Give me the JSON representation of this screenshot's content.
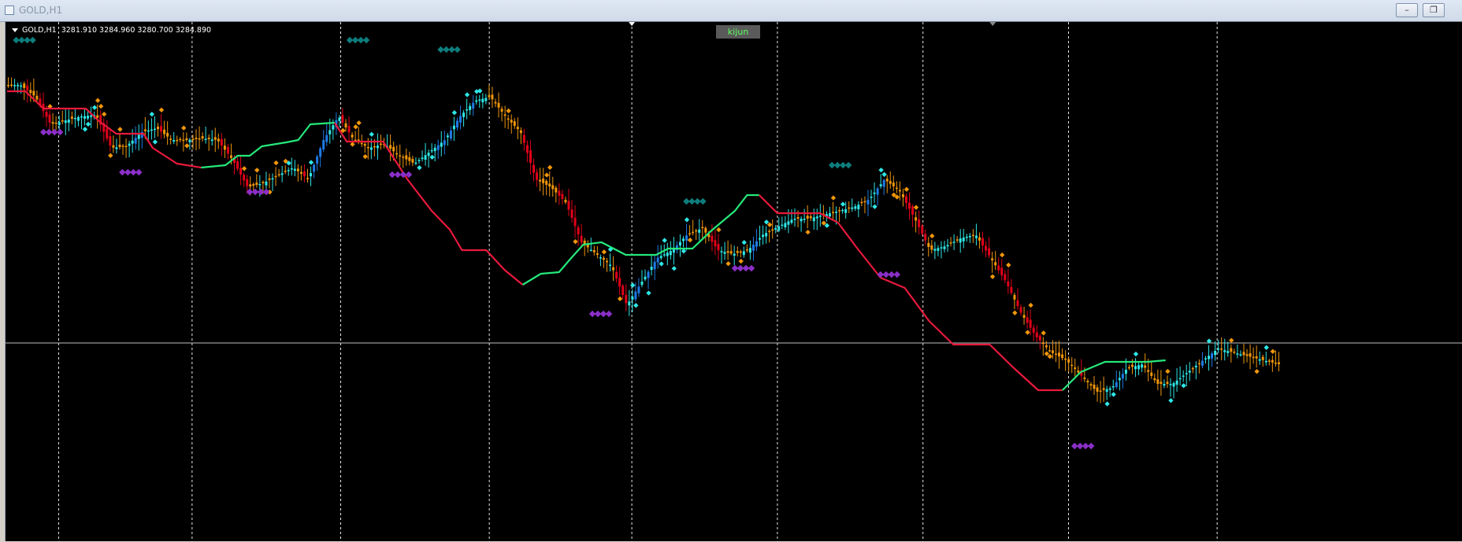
{
  "window": {
    "title": "GOLD,H1",
    "minimize_icon": "minimize-icon",
    "restore_icon": "restore-icon"
  },
  "chart": {
    "symbol_info": "GOLD,H1  3281.910 3284.960 3280.700 3284.890",
    "indicator_button": "kijun",
    "colors": {
      "background": "#000000",
      "grid": "#ffffff",
      "crosshair": "#bfbfbf",
      "bull_strong": "#1e7ae6",
      "bull_weak": "#2ee6e6",
      "bear_strong": "#e0001a",
      "bear_weak": "#f0960a",
      "kijun_bear": "#e8193c",
      "kijun_bull": "#25e87a",
      "marker_top": "#0e7d7d",
      "marker_bottom": "#8b2fc9",
      "swing_dot": "#f0960a"
    }
  },
  "chart_data": {
    "type": "candlestick",
    "title": "GOLD,H1",
    "ohlc_last": {
      "open": 3281.91,
      "high": 3284.96,
      "low": 3280.7,
      "close": 3284.89
    },
    "ylim": [
      0,
      650
    ],
    "y_axis_inverted": true,
    "x_axis": "bar index (hourly)",
    "close_path": [
      [
        0,
        80
      ],
      [
        5,
        80
      ],
      [
        10,
        95
      ],
      [
        15,
        130
      ],
      [
        20,
        125
      ],
      [
        25,
        120
      ],
      [
        30,
        118
      ],
      [
        35,
        160
      ],
      [
        40,
        158
      ],
      [
        45,
        140
      ],
      [
        50,
        135
      ],
      [
        55,
        150
      ],
      [
        60,
        150
      ],
      [
        65,
        148
      ],
      [
        70,
        150
      ],
      [
        75,
        175
      ],
      [
        80,
        210
      ],
      [
        85,
        205
      ],
      [
        90,
        195
      ],
      [
        95,
        185
      ],
      [
        100,
        200
      ],
      [
        105,
        150
      ],
      [
        110,
        120
      ],
      [
        115,
        150
      ],
      [
        120,
        160
      ],
      [
        125,
        155
      ],
      [
        130,
        170
      ],
      [
        135,
        180
      ],
      [
        140,
        165
      ],
      [
        145,
        150
      ],
      [
        150,
        120
      ],
      [
        155,
        100
      ],
      [
        160,
        95
      ],
      [
        165,
        120
      ],
      [
        170,
        140
      ],
      [
        175,
        200
      ],
      [
        180,
        210
      ],
      [
        185,
        230
      ],
      [
        190,
        280
      ],
      [
        195,
        295
      ],
      [
        200,
        310
      ],
      [
        205,
        360
      ],
      [
        210,
        330
      ],
      [
        215,
        300
      ],
      [
        220,
        290
      ],
      [
        225,
        270
      ],
      [
        230,
        262
      ],
      [
        235,
        290
      ],
      [
        240,
        295
      ],
      [
        245,
        290
      ],
      [
        250,
        270
      ],
      [
        255,
        260
      ],
      [
        260,
        250
      ],
      [
        265,
        250
      ],
      [
        270,
        245
      ],
      [
        275,
        240
      ],
      [
        280,
        235
      ],
      [
        285,
        225
      ],
      [
        290,
        200
      ],
      [
        295,
        215
      ],
      [
        300,
        250
      ],
      [
        305,
        290
      ],
      [
        310,
        285
      ],
      [
        315,
        275
      ],
      [
        320,
        270
      ],
      [
        325,
        300
      ],
      [
        330,
        330
      ],
      [
        335,
        370
      ],
      [
        340,
        400
      ],
      [
        345,
        420
      ],
      [
        350,
        430
      ],
      [
        355,
        450
      ],
      [
        360,
        470
      ],
      [
        365,
        465
      ],
      [
        370,
        440
      ],
      [
        375,
        435
      ],
      [
        380,
        460
      ],
      [
        385,
        460
      ],
      [
        390,
        445
      ],
      [
        395,
        430
      ],
      [
        400,
        415
      ],
      [
        405,
        420
      ],
      [
        410,
        425
      ],
      [
        415,
        430
      ],
      [
        420,
        435
      ]
    ],
    "kijun_segments": [
      {
        "trend": "bear",
        "points": [
          [
            0,
            88
          ],
          [
            6,
            88
          ],
          [
            12,
            110
          ],
          [
            26,
            110
          ],
          [
            30,
            125
          ],
          [
            36,
            142
          ],
          [
            45,
            142
          ],
          [
            48,
            160
          ],
          [
            56,
            180
          ],
          [
            64,
            185
          ]
        ]
      },
      {
        "trend": "bull",
        "points": [
          [
            64,
            185
          ],
          [
            72,
            182
          ],
          [
            76,
            170
          ],
          [
            80,
            170
          ],
          [
            84,
            158
          ],
          [
            92,
            153
          ],
          [
            96,
            150
          ],
          [
            100,
            130
          ],
          [
            108,
            128
          ]
        ]
      },
      {
        "trend": "bear",
        "points": [
          [
            108,
            128
          ],
          [
            112,
            152
          ],
          [
            124,
            152
          ],
          [
            132,
            200
          ],
          [
            140,
            240
          ],
          [
            146,
            264
          ],
          [
            150,
            290
          ],
          [
            158,
            290
          ],
          [
            164,
            315
          ],
          [
            170,
            334
          ]
        ]
      },
      {
        "trend": "bull",
        "points": [
          [
            170,
            334
          ],
          [
            176,
            320
          ],
          [
            182,
            318
          ],
          [
            186,
            300
          ],
          [
            190,
            283
          ],
          [
            196,
            280
          ],
          [
            204,
            296
          ],
          [
            214,
            296
          ],
          [
            218,
            288
          ],
          [
            226,
            288
          ],
          [
            232,
            266
          ],
          [
            240,
            240
          ],
          [
            244,
            220
          ],
          [
            248,
            220
          ]
        ]
      },
      {
        "trend": "bear",
        "points": [
          [
            248,
            220
          ],
          [
            254,
            243
          ],
          [
            268,
            243
          ],
          [
            274,
            255
          ],
          [
            280,
            286
          ],
          [
            288,
            325
          ],
          [
            296,
            338
          ],
          [
            304,
            380
          ],
          [
            312,
            410
          ],
          [
            324,
            410
          ],
          [
            332,
            440
          ],
          [
            340,
            468
          ],
          [
            348,
            468
          ]
        ]
      },
      {
        "trend": "bull",
        "points": [
          [
            348,
            468
          ],
          [
            354,
            445
          ],
          [
            362,
            432
          ],
          [
            376,
            432
          ],
          [
            382,
            430
          ]
        ]
      }
    ],
    "marker_clusters": [
      {
        "position": "top",
        "x": 3,
        "y": 23
      },
      {
        "position": "bottom",
        "x": 12,
        "y": 140
      },
      {
        "position": "bottom",
        "x": 38,
        "y": 191
      },
      {
        "position": "bottom",
        "x": 80,
        "y": 216
      },
      {
        "position": "top",
        "x": 113,
        "y": 23
      },
      {
        "position": "bottom",
        "x": 127,
        "y": 194
      },
      {
        "position": "top",
        "x": 143,
        "y": 35
      },
      {
        "position": "bottom",
        "x": 193,
        "y": 371
      },
      {
        "position": "top",
        "x": 224,
        "y": 228
      },
      {
        "position": "bottom",
        "x": 240,
        "y": 313
      },
      {
        "position": "top",
        "x": 272,
        "y": 182
      },
      {
        "position": "bottom",
        "x": 288,
        "y": 321
      },
      {
        "position": "bottom",
        "x": 352,
        "y": 539
      }
    ],
    "horizontal_line": {
      "y": 408
    },
    "vertical_grid": [
      17,
      61,
      110,
      159,
      206,
      254,
      302,
      350,
      399
    ]
  }
}
